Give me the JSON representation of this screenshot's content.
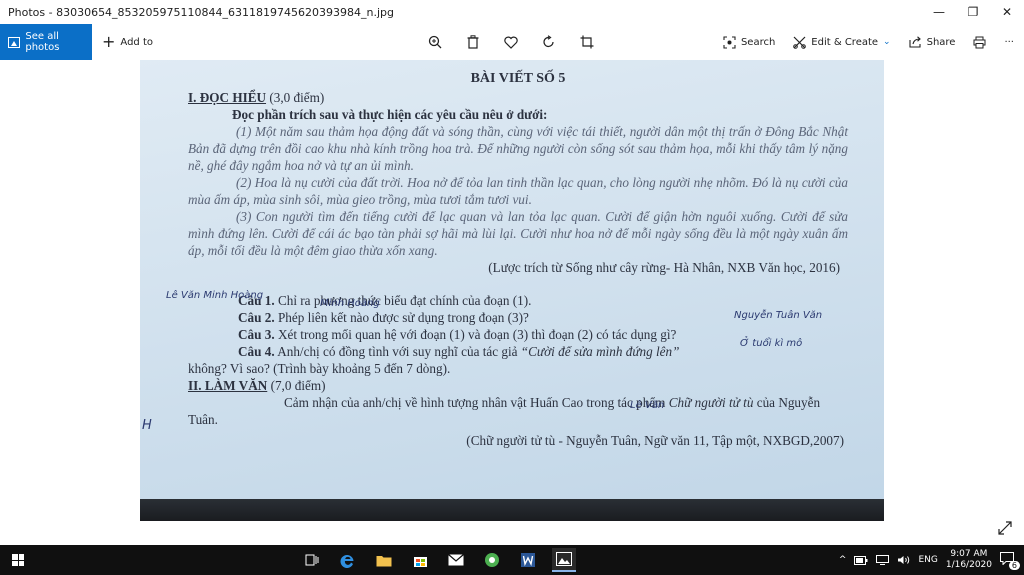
{
  "window": {
    "title": "Photos - 83030654_853205975110844_6311819745620393984_n.jpg",
    "min": "—",
    "max": "❐",
    "close": "✕"
  },
  "toolbar": {
    "see_all": "See all photos",
    "add_to": "Add to",
    "search": "Search",
    "edit_create": "Edit & Create",
    "share": "Share",
    "more": "···"
  },
  "doc": {
    "heading": "BÀI VIẾT SỐ 5",
    "sec1_title": "I. ĐỌC HIỂU",
    "sec1_pts": "(3,0 điểm)",
    "instruction": "Đọc phần trích sau và thực hiện các yêu cầu nêu ở dưới:",
    "p1": "(1) Một năm sau thảm họa động đất và sóng thần, cùng với việc tái thiết, người dân một thị trấn ở Đông Bắc Nhật Bản đã dựng trên đồi cao khu nhà kính trồng hoa trà. Để những người còn sống sót sau thảm họa, mỗi khi thấy tâm lý nặng nề, ghé đây ngắm hoa nở và tự an ủi mình.",
    "p2": "(2) Hoa là nụ cười của đất trời. Hoa nở để tỏa lan tinh thần lạc quan, cho lòng người nhẹ nhõm. Đó là nụ cười của mùa ấm áp, mùa sinh sôi, mùa gieo trồng, mùa tươi tắm tươi vui.",
    "p3": "(3) Con người tìm đến tiếng cười để lạc quan và lan tỏa lạc quan. Cười để giận hờn nguôi xuống. Cười để sửa mình đứng lên. Cười để cái ác bạo tàn phải sợ hãi mà lùi lại. Cười như hoa nở để mỗi ngày sống đều là một ngày xuân ấm áp, mỗi tối đều là một đêm giao thừa xốn xang.",
    "source": "(Lược trích từ Sống như cây rừng- Hà Nhân, NXB Văn học, 2016)",
    "q1_label": "Câu 1.",
    "q1": "Chỉ ra phương thức biểu đạt chính của đoạn (1).",
    "q2_label": "Câu 2.",
    "q2": "Phép liên kết nào được sử dụng trong đoạn (3)?",
    "q3_label": "Câu 3.",
    "q3": "Xét trong mối quan hệ với đoạn (1) và đoạn (3) thì đoạn (2) có tác dụng gì?",
    "q4_label": "Câu 4.",
    "q4_a": "Anh/chị có đồng tình với suy nghĩ của tác giả",
    "q4_quote": "“Cười để sửa mình đứng lên”",
    "q4_b": "không? Vì sao? (Trình bày khoảng 5 đến 7 dòng).",
    "sec2_title": "II. LÀM VĂN",
    "sec2_pts": "(7,0 điểm)",
    "essay_a": "Cảm nhận của anh/chị về hình tượng nhân vật Huấn Cao trong tác phẩm",
    "essay_work": "Chữ người tử tù",
    "essay_b": "của Nguyễn Tuân.",
    "essay_src": "(Chữ người tử tù - Nguyễn Tuân, Ngữ văn 11, Tập một, NXBGD,2007)"
  },
  "handwriting": {
    "name1": "Lê Văn Minh Hoàng",
    "name2": "Minh Hoàng",
    "note1": "Nguyễn Tuân Văn",
    "note2": "Ở tuổi kì mô",
    "name3": "Lê Văn",
    "mark": "H"
  },
  "tray": {
    "lang": "ENG",
    "time": "9:07 AM",
    "date": "1/16/2020",
    "notif": "6"
  },
  "colors": {
    "accent": "#0b6fc7",
    "taskbar": "#101010",
    "paper": "#cfe0ee"
  }
}
